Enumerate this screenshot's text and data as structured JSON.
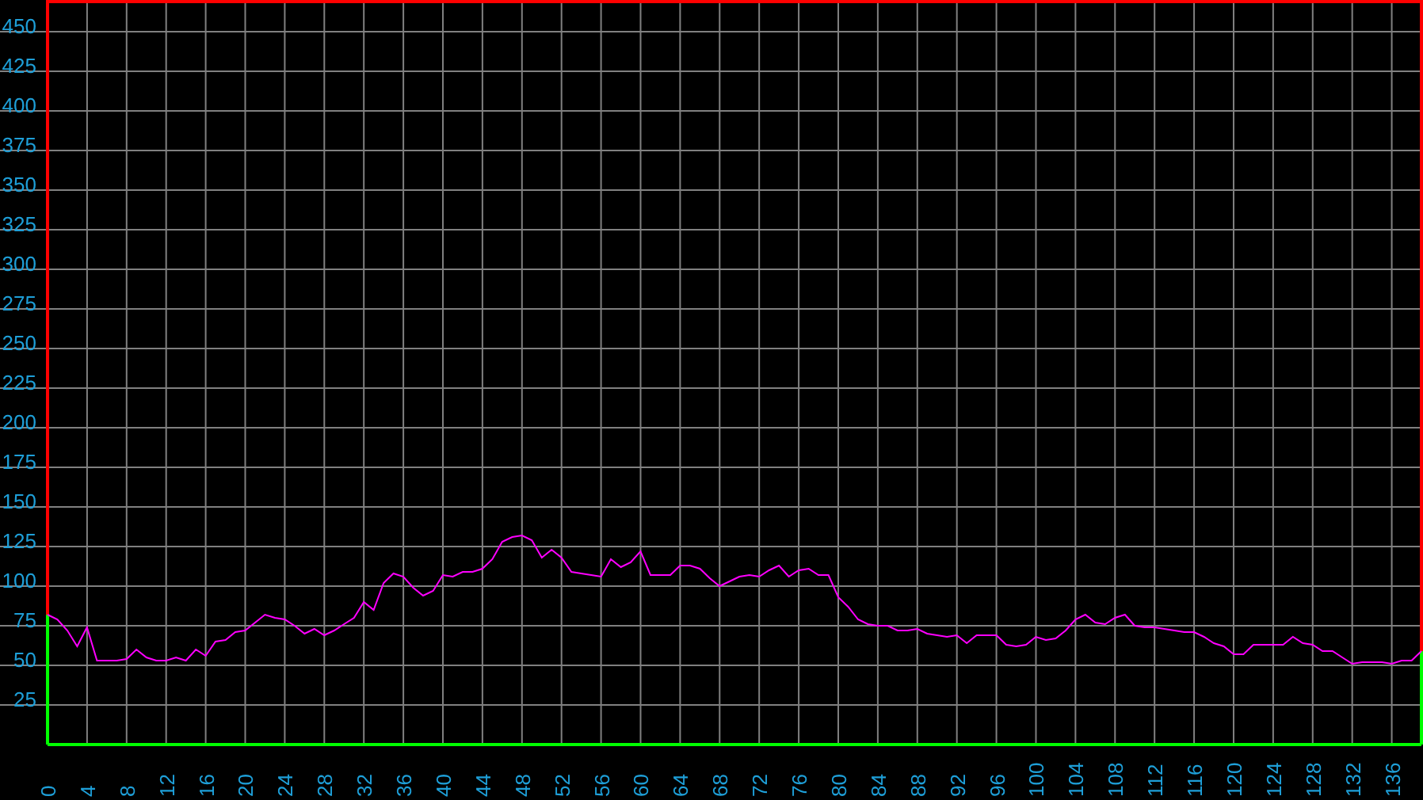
{
  "chart_data": {
    "type": "line",
    "values": [
      82,
      79,
      72,
      62,
      74,
      53,
      53,
      53,
      54,
      60,
      55,
      53,
      53,
      55,
      53,
      60,
      56,
      65,
      66,
      71,
      72,
      77,
      82,
      80,
      79,
      75,
      70,
      73,
      69,
      72,
      76,
      80,
      90,
      85,
      102,
      108,
      106,
      99,
      94,
      97,
      107,
      106,
      109,
      109,
      111,
      117,
      128,
      131,
      132,
      129,
      118,
      123,
      118,
      109,
      108,
      107,
      106,
      117,
      112,
      115,
      122,
      107,
      107,
      107,
      113,
      113,
      111,
      105,
      100,
      103,
      106,
      107,
      106,
      110,
      113,
      106,
      110,
      111,
      107,
      107,
      93,
      87,
      79,
      76,
      75,
      75,
      72,
      72,
      73,
      70,
      69,
      68,
      69,
      64,
      69,
      69,
      69,
      63,
      62,
      63,
      68,
      66,
      67,
      72,
      79,
      82,
      77,
      76,
      80,
      82,
      75,
      74,
      74,
      73,
      72,
      71,
      71,
      68,
      64,
      62,
      57,
      57,
      63,
      63,
      63,
      63,
      68,
      64,
      63,
      59,
      59,
      55,
      51,
      52,
      52,
      52,
      51,
      53,
      53,
      59
    ],
    "x": [
      0,
      1,
      2,
      3,
      4,
      5,
      6,
      7,
      8,
      9,
      10,
      11,
      12,
      13,
      14,
      15,
      16,
      17,
      18,
      19,
      20,
      21,
      22,
      23,
      24,
      25,
      26,
      27,
      28,
      29,
      30,
      31,
      32,
      33,
      34,
      35,
      36,
      37,
      38,
      39,
      40,
      41,
      42,
      43,
      44,
      45,
      46,
      47,
      48,
      49,
      50,
      51,
      52,
      53,
      54,
      55,
      56,
      57,
      58,
      59,
      60,
      61,
      62,
      63,
      64,
      65,
      66,
      67,
      68,
      69,
      70,
      71,
      72,
      73,
      74,
      75,
      76,
      77,
      78,
      79,
      80,
      81,
      82,
      83,
      84,
      85,
      86,
      87,
      88,
      89,
      90,
      91,
      92,
      93,
      94,
      95,
      96,
      97,
      98,
      99,
      100,
      101,
      102,
      103,
      104,
      105,
      106,
      107,
      108,
      109,
      110,
      111,
      112,
      113,
      114,
      115,
      116,
      117,
      118,
      119,
      120,
      121,
      122,
      123,
      124,
      125,
      126,
      127,
      128,
      129,
      130,
      131,
      132,
      133,
      134,
      135,
      136,
      137,
      138,
      139
    ],
    "xlim": [
      0,
      139
    ],
    "ylim": [
      0,
      470
    ],
    "grid": true,
    "xticks": [
      0,
      4,
      8,
      12,
      16,
      20,
      24,
      28,
      32,
      36,
      40,
      44,
      48,
      52,
      56,
      60,
      64,
      68,
      72,
      76,
      80,
      84,
      88,
      92,
      96,
      100,
      104,
      108,
      112,
      116,
      120,
      124,
      128,
      132,
      136
    ],
    "yticks": [
      25,
      50,
      75,
      100,
      125,
      150,
      175,
      200,
      225,
      250,
      275,
      300,
      325,
      350,
      375,
      400,
      425,
      450
    ]
  }
}
